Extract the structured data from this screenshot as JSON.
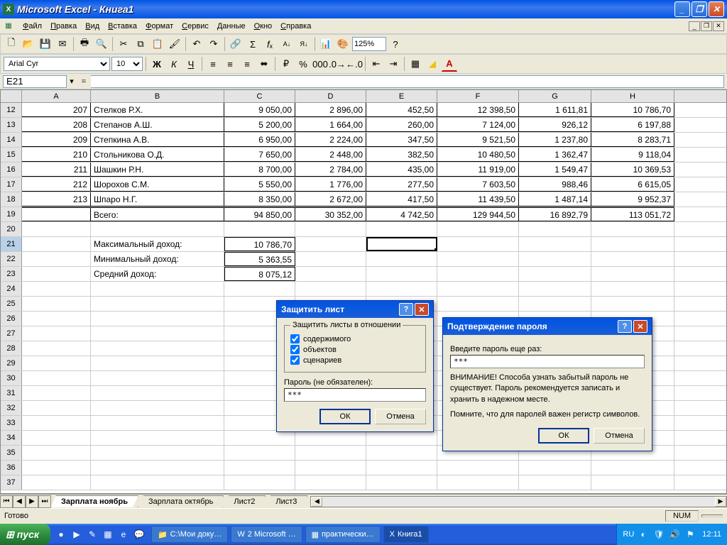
{
  "app": {
    "title": "Microsoft Excel - Книга1"
  },
  "menu": [
    "Файл",
    "Правка",
    "Вид",
    "Вставка",
    "Формат",
    "Сервис",
    "Данные",
    "Окно",
    "Справка"
  ],
  "formatting": {
    "font": "Arial Cyr",
    "size": "10",
    "zoom": "125%"
  },
  "formulabar": {
    "cellref": "E21",
    "value": ""
  },
  "columns": [
    "A",
    "B",
    "C",
    "D",
    "E",
    "F",
    "G",
    "H"
  ],
  "colwidths": [
    "wA",
    "wB",
    "wC",
    "wD",
    "wE",
    "wF",
    "wG",
    "wH"
  ],
  "rows": [
    {
      "n": 12,
      "b": true,
      "cells": [
        "207",
        "Стелков Р.Х.",
        "9 050,00",
        "2 896,00",
        "452,50",
        "12 398,50",
        "1 611,81",
        "10 786,70"
      ]
    },
    {
      "n": 13,
      "b": true,
      "cells": [
        "208",
        "Степанов А.Ш.",
        "5 200,00",
        "1 664,00",
        "260,00",
        "7 124,00",
        "926,12",
        "6 197,88"
      ]
    },
    {
      "n": 14,
      "b": true,
      "cells": [
        "209",
        "Степкина А.В.",
        "6 950,00",
        "2 224,00",
        "347,50",
        "9 521,50",
        "1 237,80",
        "8 283,71"
      ]
    },
    {
      "n": 15,
      "b": true,
      "cells": [
        "210",
        "Стольникова О.Д.",
        "7 650,00",
        "2 448,00",
        "382,50",
        "10 480,50",
        "1 362,47",
        "9 118,04"
      ]
    },
    {
      "n": 16,
      "b": true,
      "cells": [
        "211",
        "Шашкин Р.Н.",
        "8 700,00",
        "2 784,00",
        "435,00",
        "11 919,00",
        "1 549,47",
        "10 369,53"
      ]
    },
    {
      "n": 17,
      "b": true,
      "cells": [
        "212",
        "Шорохов С.М.",
        "5 550,00",
        "1 776,00",
        "277,50",
        "7 603,50",
        "988,46",
        "6 615,05"
      ]
    },
    {
      "n": 18,
      "b": true,
      "cells": [
        "213",
        "Шпаро Н.Г.",
        "8 350,00",
        "2 672,00",
        "417,50",
        "11 439,50",
        "1 487,14",
        "9 952,37"
      ]
    },
    {
      "n": 19,
      "b": true,
      "total": true,
      "cells": [
        "",
        "Всего:",
        "94 850,00",
        "30 352,00",
        "4 742,50",
        "129 944,50",
        "16 892,79",
        "113 051,72"
      ]
    },
    {
      "n": 20,
      "cells": [
        "",
        "",
        "",
        "",
        "",
        "",
        "",
        ""
      ]
    },
    {
      "n": 21,
      "sel": true,
      "cells": [
        "",
        "Максимальный доход:",
        "10 786,70",
        "",
        "",
        "",
        "",
        ""
      ],
      "sumC": true,
      "selE": true
    },
    {
      "n": 22,
      "cells": [
        "",
        "Минимальный доход:",
        "5 363,55",
        "",
        "",
        "",
        "",
        ""
      ],
      "sumC": true
    },
    {
      "n": 23,
      "cells": [
        "",
        "Средний доход:",
        "8 075,12",
        "",
        "",
        "",
        "",
        ""
      ],
      "sumC": true
    },
    {
      "n": 24,
      "cells": [
        "",
        "",
        "",
        "",
        "",
        "",
        "",
        ""
      ]
    },
    {
      "n": 25,
      "cells": [
        "",
        "",
        "",
        "",
        "",
        "",
        "",
        ""
      ]
    },
    {
      "n": 26,
      "cells": [
        "",
        "",
        "",
        "",
        "",
        "",
        "",
        ""
      ]
    },
    {
      "n": 27,
      "cells": [
        "",
        "",
        "",
        "",
        "",
        "",
        "",
        ""
      ]
    },
    {
      "n": 28,
      "cells": [
        "",
        "",
        "",
        "",
        "",
        "",
        "",
        ""
      ]
    },
    {
      "n": 29,
      "cells": [
        "",
        "",
        "",
        "",
        "",
        "",
        "",
        ""
      ]
    },
    {
      "n": 30,
      "cells": [
        "",
        "",
        "",
        "",
        "",
        "",
        "",
        ""
      ]
    },
    {
      "n": 31,
      "cells": [
        "",
        "",
        "",
        "",
        "",
        "",
        "",
        ""
      ]
    },
    {
      "n": 32,
      "cells": [
        "",
        "",
        "",
        "",
        "",
        "",
        "",
        ""
      ]
    },
    {
      "n": 33,
      "cells": [
        "",
        "",
        "",
        "",
        "",
        "",
        "",
        ""
      ]
    },
    {
      "n": 34,
      "cells": [
        "",
        "",
        "",
        "",
        "",
        "",
        "",
        ""
      ]
    },
    {
      "n": 35,
      "cells": [
        "",
        "",
        "",
        "",
        "",
        "",
        "",
        ""
      ]
    },
    {
      "n": 36,
      "cells": [
        "",
        "",
        "",
        "",
        "",
        "",
        "",
        ""
      ]
    },
    {
      "n": 37,
      "cells": [
        "",
        "",
        "",
        "",
        "",
        "",
        "",
        ""
      ]
    }
  ],
  "sheets": [
    "Зарплата ноябрь",
    "Зарплата октябрь",
    "Лист2",
    "Лист3"
  ],
  "active_sheet": 0,
  "status": {
    "ready": "Готово",
    "num": "NUM"
  },
  "dialog1": {
    "title": "Защитить лист",
    "fieldset": "Защитить листы в отношении",
    "chk1": "содержимого",
    "chk2": "объектов",
    "chk3": "сценариев",
    "pwlabel": "Пароль (не обязателен):",
    "pwvalue": "***",
    "ok": "ОК",
    "cancel": "Отмена"
  },
  "dialog2": {
    "title": "Подтверждение пароля",
    "label": "Введите пароль еще раз:",
    "pwvalue": "***",
    "warn1": "ВНИМАНИЕ! Способа узнать забытый пароль не существует. Пароль рекомендуется записать и хранить в надежном месте.",
    "warn2": "Помните, что для паролей важен регистр символов.",
    "ok": "ОК",
    "cancel": "Отмена"
  },
  "taskbar": {
    "start": "пуск",
    "tasks": [
      "С:\\Мои доку…",
      "2 Microsoft …",
      "практически…",
      "Книга1"
    ],
    "lang": "RU",
    "time": "12:11"
  }
}
